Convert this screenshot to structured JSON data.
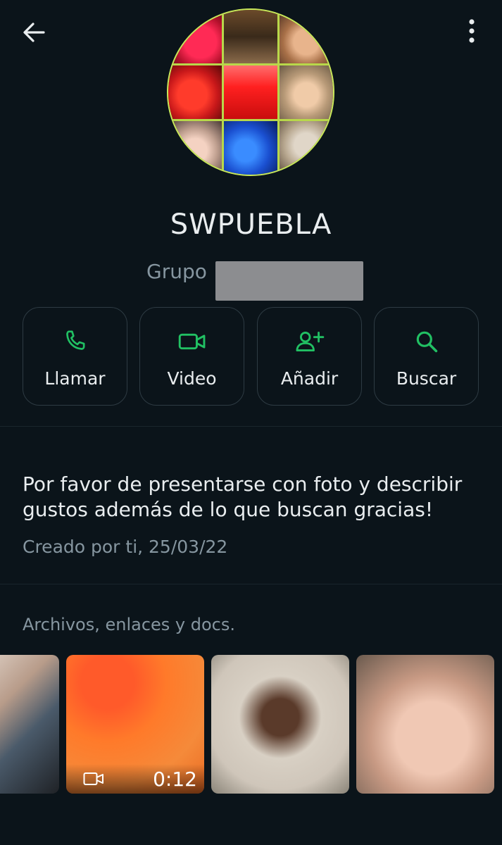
{
  "header": {
    "back_icon": "arrow-left-icon",
    "menu_icon": "more-vert-icon"
  },
  "profile": {
    "avatar_icon": "group-avatar-collage",
    "name": "SWPUEBLA",
    "subtitle": "Grupo"
  },
  "actions": [
    {
      "icon": "phone-icon",
      "label": "Llamar"
    },
    {
      "icon": "video-camera-icon",
      "label": "Video"
    },
    {
      "icon": "add-person-icon",
      "label": "Añadir"
    },
    {
      "icon": "search-icon",
      "label": "Buscar"
    }
  ],
  "description": {
    "text": "Por favor de presentarse con foto y describir gustos  además de lo que buscan gracias!",
    "created": "Creado por ti, 25/03/22"
  },
  "media": {
    "title": "Archivos, enlaces y docs.",
    "items": [
      {
        "kind": "image"
      },
      {
        "kind": "video",
        "duration": "0:12"
      },
      {
        "kind": "image"
      },
      {
        "kind": "image"
      }
    ]
  },
  "colors": {
    "background": "#0b141a",
    "accent": "#21c063",
    "text_primary": "#e9edef",
    "text_secondary": "#8696a0"
  }
}
